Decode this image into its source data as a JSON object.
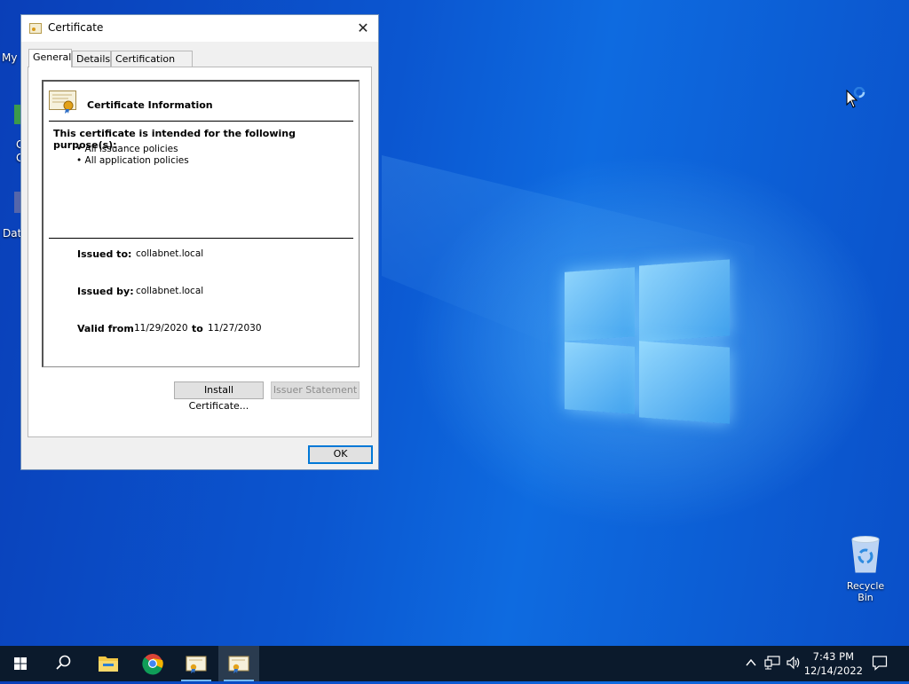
{
  "desktop": {
    "left_icons": [
      {
        "label": "My"
      },
      {
        "label": "C"
      },
      {
        "label": "C"
      },
      {
        "label": "Data"
      }
    ],
    "recycle_bin_label": "Recycle Bin"
  },
  "dialog": {
    "title": "Certificate",
    "close_glyph": "✕",
    "tabs": [
      {
        "label": "General",
        "active": true
      },
      {
        "label": "Details",
        "active": false
      },
      {
        "label": "Certification Path",
        "active": false
      }
    ],
    "info_title": "Certificate Information",
    "purpose_title": "This certificate is intended for the following purpose(s):",
    "purposes": [
      "• All issuance policies",
      "• All application policies"
    ],
    "issued_to_label": "Issued to:",
    "issued_to": "collabnet.local",
    "issued_by_label": "Issued by:",
    "issued_by": "collabnet.local",
    "valid_from_label": "Valid from",
    "valid_from": "11/29/2020",
    "valid_to_label": "to",
    "valid_to": "11/27/2030",
    "install_button": "Install Certificate...",
    "issuer_statement_button": "Issuer Statement",
    "ok_button": "OK"
  },
  "taskbar": {
    "time": "7:43 PM",
    "date": "12/14/2022",
    "icons": [
      "windows-start-icon",
      "search-icon",
      "file-explorer-icon",
      "chrome-icon",
      "certificate-icon",
      "certificate-icon"
    ]
  },
  "colors": {
    "accent": "#0078d7",
    "taskbar": "#0b1a2c",
    "desktop_blue": "#0b56d0"
  }
}
